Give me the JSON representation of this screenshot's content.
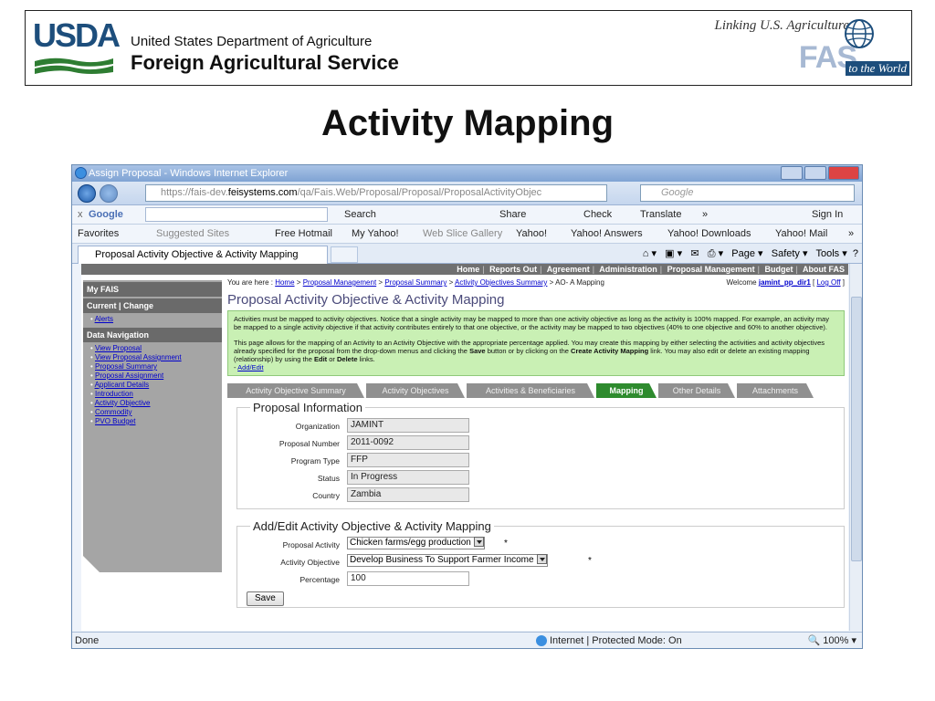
{
  "slide": {
    "org_logo": "USDA",
    "dept_name": "United States Department of Agriculture",
    "service_name": "Foreign Agricultural Service",
    "tagline": "Linking U.S. Agriculture",
    "tagline_tail": "to the World",
    "fas_logo": "FAS",
    "title": "Activity Mapping"
  },
  "browser": {
    "window_title": "Assign Proposal - Windows Internet Explorer",
    "address_prefix": "https://fais-dev.",
    "address_domain": "feisystems.com",
    "address_path": "/qa/Fais.Web/Proposal/Proposal/ProposalActivityObjec",
    "search_placeholder": "Google",
    "toolbar": {
      "google_label": "Google",
      "search": "Search",
      "share": "Share",
      "check": "Check",
      "translate": "Translate",
      "more": "»",
      "sign_in": "Sign In"
    },
    "favorites": {
      "favorites_label": "Favorites",
      "items": [
        "Suggested Sites",
        "Free Hotmail",
        "My Yahoo!",
        "Web Slice Gallery",
        "Yahoo!",
        "Yahoo! Answers",
        "Yahoo! Downloads",
        "Yahoo! Mail"
      ],
      "more": "»"
    },
    "tab_title": "Proposal Activity Objective & Activity Mapping",
    "command_bar": {
      "page": "Page",
      "safety": "Safety",
      "tools": "Tools"
    },
    "status": {
      "left": "Done",
      "zone": "Internet | Protected Mode: On",
      "zoom": "100%"
    }
  },
  "app": {
    "topnav": [
      "Home",
      "Reports Out",
      "Agreement",
      "Administration",
      "Proposal Management",
      "Budget",
      "About FAS"
    ],
    "sidebar": {
      "header": "My FAIS",
      "current": "Current | Change",
      "alerts": "Alerts",
      "data_nav": "Data Navigation",
      "links": [
        "View Proposal",
        "View Proposal Assignment",
        "Proposal Summary",
        "Proposal Assignment",
        "Applicant Details",
        "Introduction",
        "Activity Objective",
        "Commodity",
        "PVO Budget"
      ]
    },
    "breadcrumb": {
      "prefix": "You are here :",
      "items": [
        "Home",
        "Proposal Management",
        "Proposal Summary",
        "Activity Objectives Summary"
      ],
      "current": "AO- A Mapping",
      "sep": ">"
    },
    "welcome": {
      "label": "Welcome",
      "user": "jamint_pp_dir1",
      "logoff": "Log Off"
    },
    "page_title": "Proposal Activity Objective & Activity Mapping",
    "info": {
      "p1": "Activities must be mapped to activity objectives. Notice that a single activity may be mapped to more than one activity objective as long as the activity is 100% mapped. For example, an activity may be mapped to a single activity objective if that activity contributes entirely to that one objective, or the activity may be mapped to two objectives (40% to one objective and 60% to another objective).",
      "p2_a": "This page allows for the mapping of an Activity to an Activity Objective with the appropriate percentage applied. You may create this mapping by either selecting the activities and activity objectives already specified for the proposal from the drop-down menus and clicking the",
      "p2_save": "Save",
      "p2_b": "button or by clicking on the",
      "p2_create": "Create Activity Mapping",
      "p2_c": "link. You may also edit or delete an existing mapping (relationship) by using the",
      "p2_edit": "Edit",
      "p2_or": "or",
      "p2_delete": "Delete",
      "p2_d": "links.",
      "add_edit": "Add/Edit"
    },
    "tabs": [
      "Activity Objective Summary",
      "Activity Objectives",
      "Activities & Beneficiaries",
      "Mapping",
      "Other Details",
      "Attachments"
    ],
    "proposal_info": {
      "legend": "Proposal Information",
      "fields": [
        {
          "label": "Organization",
          "value": "JAMINT"
        },
        {
          "label": "Proposal Number",
          "value": "2011-0092"
        },
        {
          "label": "Program Type",
          "value": "FFP"
        },
        {
          "label": "Status",
          "value": "In Progress"
        },
        {
          "label": "Country",
          "value": "Zambia"
        }
      ]
    },
    "mapping_form": {
      "legend": "Add/Edit Activity Objective & Activity Mapping",
      "activity_label": "Proposal Activity",
      "activity_value": "Chicken farms/egg production",
      "objective_label": "Activity Objective",
      "objective_value": "Develop Business To Support Farmer Income",
      "percentage_label": "Percentage",
      "percentage_value": "100",
      "required_mark": "*",
      "save_label": "Save"
    }
  }
}
